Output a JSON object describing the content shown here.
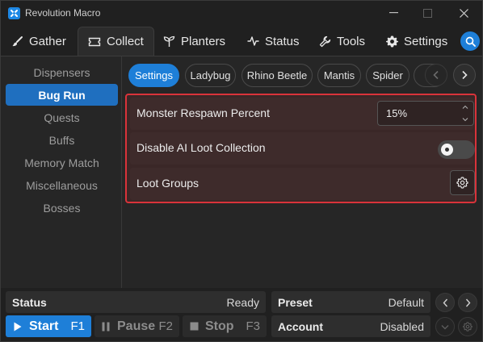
{
  "window": {
    "title": "Revolution Macro"
  },
  "nav": {
    "tabs": [
      {
        "label": "Gather",
        "icon": "brush-icon"
      },
      {
        "label": "Collect",
        "icon": "ticket-icon",
        "active": true
      },
      {
        "label": "Planters",
        "icon": "sprout-icon"
      },
      {
        "label": "Status",
        "icon": "pulse-icon"
      },
      {
        "label": "Tools",
        "icon": "wrench-icon"
      },
      {
        "label": "Settings",
        "icon": "gear-icon"
      }
    ]
  },
  "sidebar": {
    "items": [
      {
        "label": "Dispensers"
      },
      {
        "label": "Bug Run",
        "active": true
      },
      {
        "label": "Quests"
      },
      {
        "label": "Buffs"
      },
      {
        "label": "Memory Match"
      },
      {
        "label": "Miscellaneous"
      },
      {
        "label": "Bosses"
      }
    ]
  },
  "subtabs": {
    "items": [
      {
        "label": "Settings",
        "active": true
      },
      {
        "label": "Ladybug"
      },
      {
        "label": "Rhino Beetle"
      },
      {
        "label": "Mantis"
      },
      {
        "label": "Spider"
      }
    ]
  },
  "settings": {
    "respawn_label": "Monster Respawn Percent",
    "respawn_value": "15%",
    "loot_label": "Disable AI Loot Collection",
    "loot_enabled": false,
    "groups_label": "Loot Groups"
  },
  "status": {
    "status_label": "Status",
    "status_value": "Ready",
    "preset_label": "Preset",
    "preset_value": "Default",
    "account_label": "Account",
    "account_value": "Disabled"
  },
  "controls": {
    "start_label": "Start",
    "start_key": "F1",
    "pause_label": "Pause",
    "pause_key": "F2",
    "stop_label": "Stop",
    "stop_key": "F3"
  },
  "colors": {
    "accent": "#1e7fd8",
    "highlight_border": "#d9333a",
    "active_sidebar": "#1f6fbf"
  }
}
